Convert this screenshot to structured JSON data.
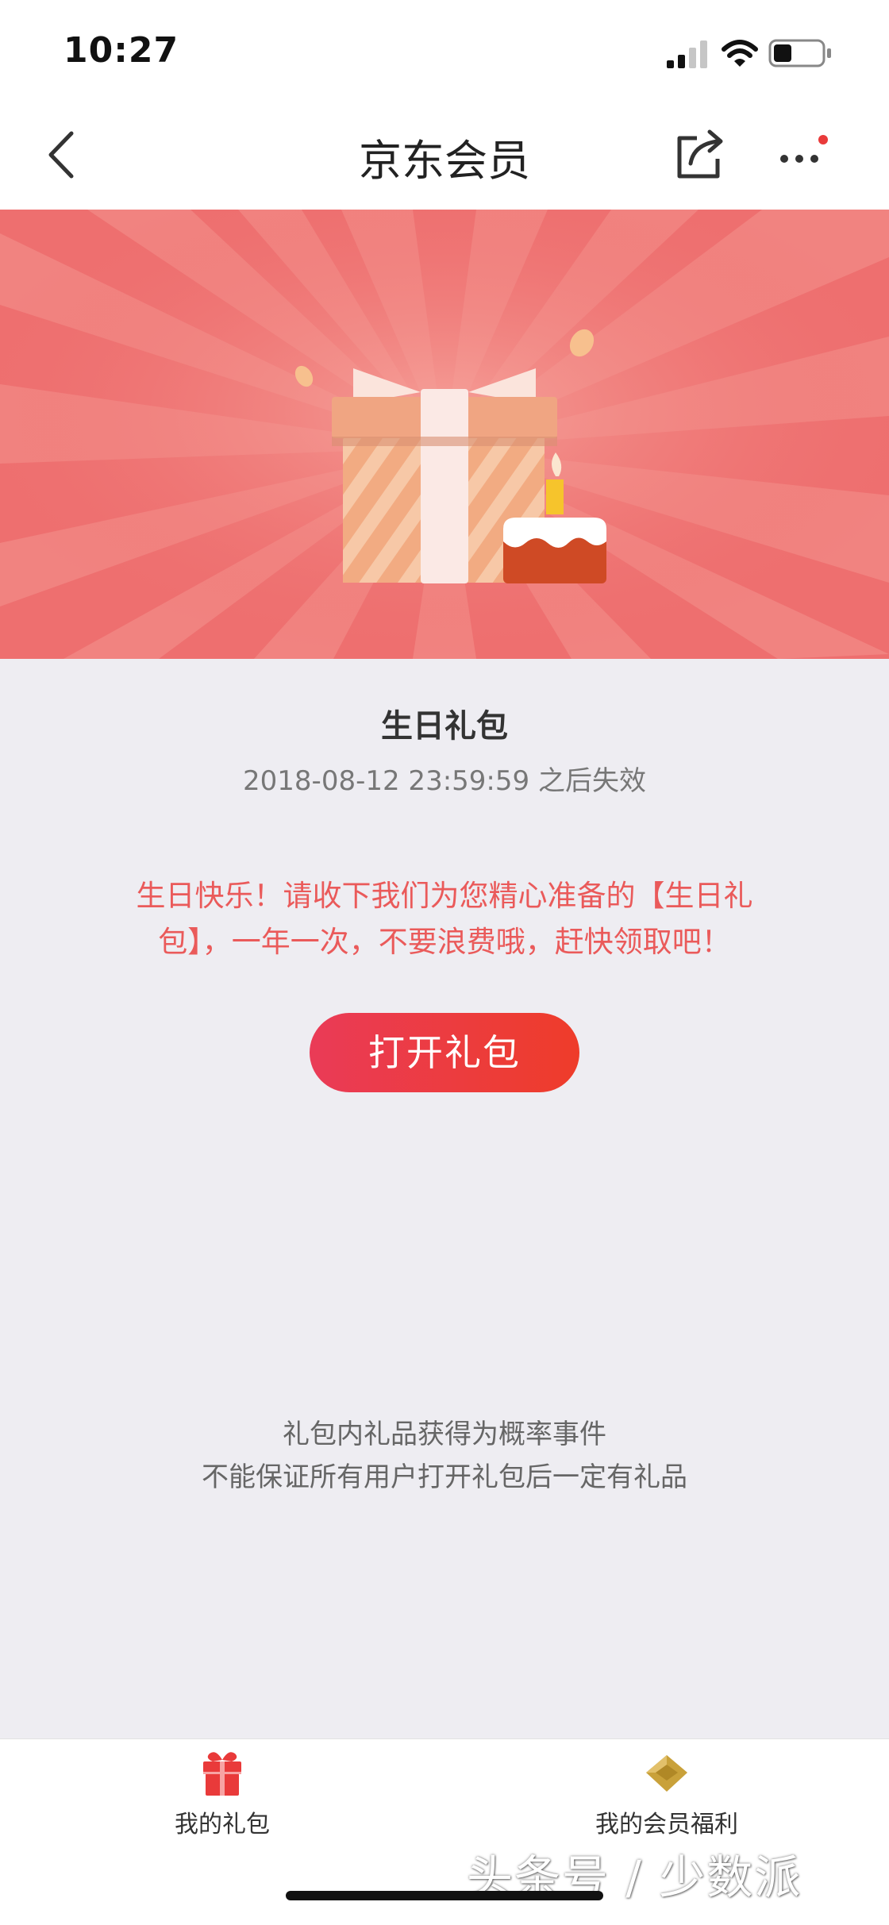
{
  "status_bar": {
    "time": "10:27",
    "icons": [
      "cellular-signal-icon",
      "wifi-icon",
      "battery-icon"
    ]
  },
  "nav": {
    "title": "京东会员",
    "back_icon": "chevron-left-icon",
    "share_icon": "share-icon",
    "more_icon": "more-dots-icon"
  },
  "banner": {
    "illustration": "gift-box-with-birthday-cake",
    "background_color": "#ee6f6f"
  },
  "gift": {
    "title": "生日礼包",
    "expiry": "2018-08-12 23:59:59 之后失效",
    "message": "生日快乐！请收下我们为您精心准备的【生日礼包】，一年一次，不要浪费哦，赶快领取吧！",
    "open_button": "打开礼包"
  },
  "notice": {
    "line1": "礼包内礼品获得为概率事件",
    "line2": "不能保证所有用户打开礼包后一定有礼品"
  },
  "tabs": [
    {
      "label": "我的礼包",
      "icon": "gift-icon",
      "color": "#e93a3a"
    },
    {
      "label": "我的会员福利",
      "icon": "diamond-icon",
      "color": "#c9a13a"
    }
  ],
  "watermark": "头条号 / 少数派",
  "colors": {
    "accent": "#ea5a5a",
    "button_start": "#ea3b57",
    "button_end": "#ee3c2a",
    "page_bg": "#eeedf2"
  }
}
